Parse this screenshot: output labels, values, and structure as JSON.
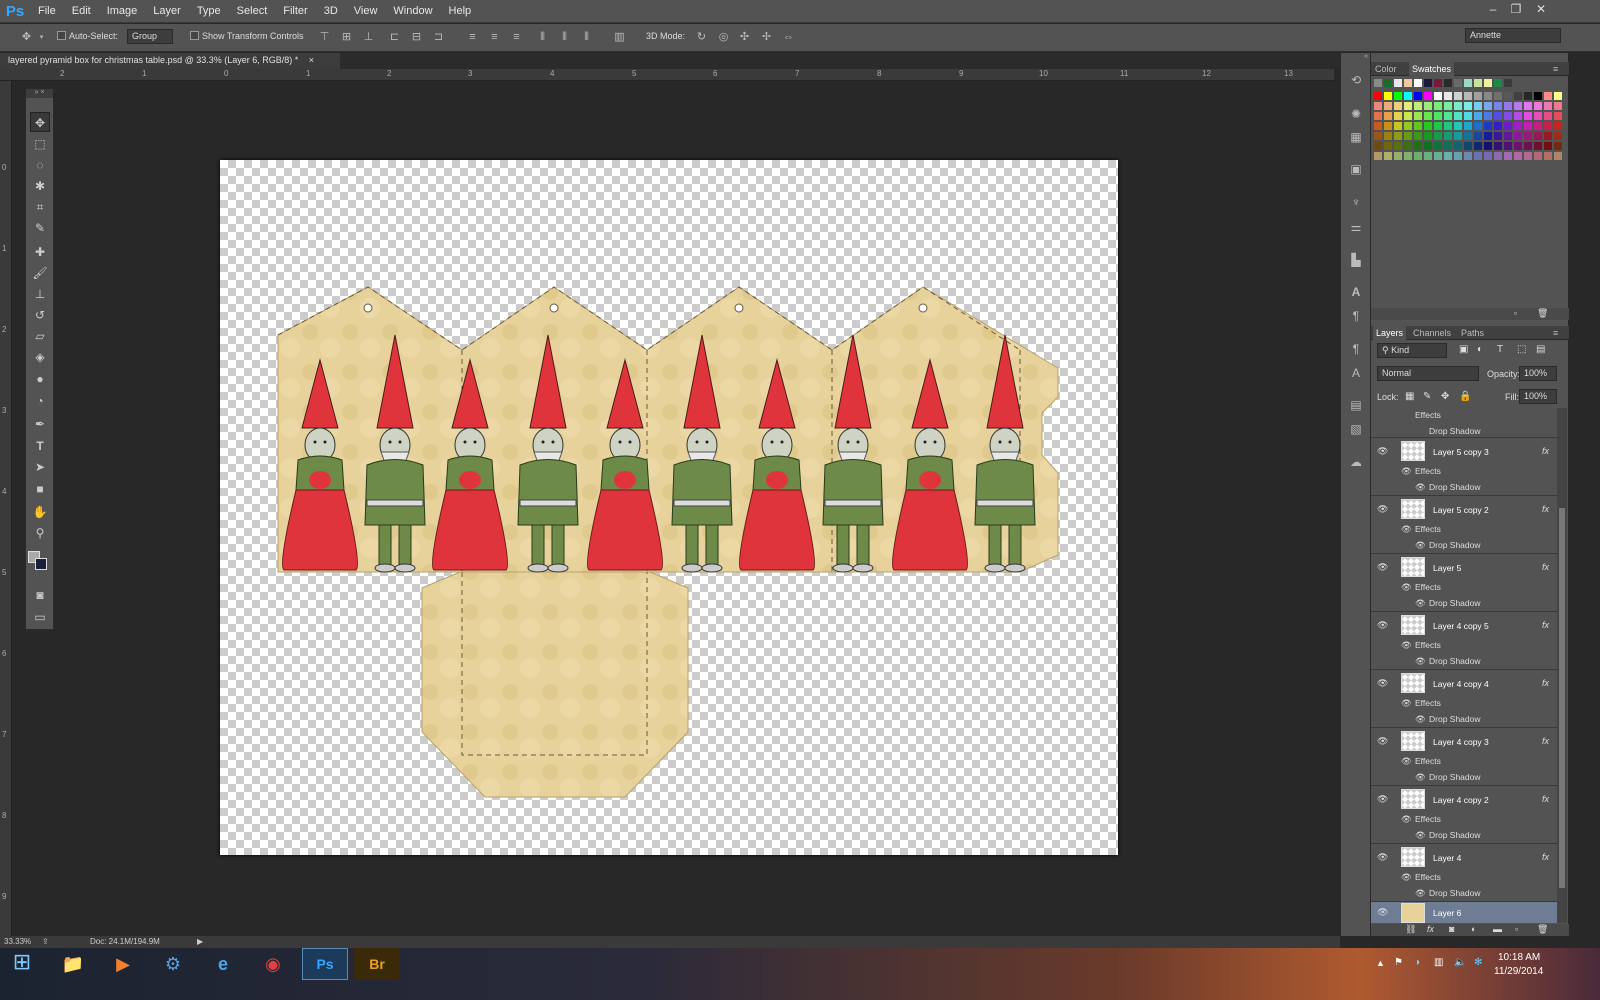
{
  "app": {
    "logo": "Ps"
  },
  "menu": [
    "File",
    "Edit",
    "Image",
    "Layer",
    "Type",
    "Select",
    "Filter",
    "3D",
    "View",
    "Window",
    "Help"
  ],
  "options": {
    "auto_select_label": "Auto-Select:",
    "auto_select_value": "Group",
    "show_transform_label": "Show Transform Controls",
    "mode_label": "3D Mode:",
    "workspace": "Annette"
  },
  "document": {
    "tab_title": "layered pyramid box for christmas table.psd @ 33.3% (Layer 6, RGB/8) *",
    "close": "×"
  },
  "ruler": {
    "h_labels": [
      "2",
      "1",
      "0",
      "1",
      "2",
      "3",
      "4",
      "5",
      "6",
      "7",
      "8",
      "9",
      "10",
      "11",
      "12",
      "13"
    ],
    "v_labels": [
      "0",
      "1",
      "2",
      "3",
      "4",
      "5",
      "6",
      "7",
      "8",
      "9"
    ]
  },
  "status": {
    "zoom": "33.33%",
    "doc": "Doc: 24.1M/194.9M"
  },
  "panels": {
    "color_tabs": [
      "Color",
      "Swatches"
    ],
    "layer_tabs": [
      "Layers",
      "Channels",
      "Paths"
    ],
    "kind": "Kind",
    "blend": "Normal",
    "opacity_label": "Opacity:",
    "opacity": "100%",
    "lock_label": "Lock:",
    "fill_label": "Fill:",
    "fill": "100%"
  },
  "layers_top": {
    "effects": "Effects",
    "drop_shadow": "Drop Shadow"
  },
  "layers": [
    {
      "name": "Layer 5 copy 3",
      "fx": "fx",
      "effects": "Effects",
      "shadow": "Drop Shadow"
    },
    {
      "name": "Layer 5 copy 2",
      "fx": "fx",
      "effects": "Effects",
      "shadow": "Drop Shadow"
    },
    {
      "name": "Layer 5",
      "fx": "fx",
      "effects": "Effects",
      "shadow": "Drop Shadow"
    },
    {
      "name": "Layer 4 copy 5",
      "fx": "fx",
      "effects": "Effects",
      "shadow": "Drop Shadow"
    },
    {
      "name": "Layer 4 copy 4",
      "fx": "fx",
      "effects": "Effects",
      "shadow": "Drop Shadow"
    },
    {
      "name": "Layer 4 copy 3",
      "fx": "fx",
      "effects": "Effects",
      "shadow": "Drop Shadow"
    },
    {
      "name": "Layer 4 copy 2",
      "fx": "fx",
      "effects": "Effects",
      "shadow": "Drop Shadow"
    },
    {
      "name": "Layer 4",
      "fx": "fx",
      "effects": "Effects",
      "shadow": "Drop Shadow"
    }
  ],
  "selected_layer": "Layer 6",
  "taskbar": {
    "time": "10:18 AM",
    "date": "11/29/2014"
  },
  "colors": {
    "selected_layer_bg": "#6f7d94",
    "paper": "#e6d29a",
    "hat_red": "#e0343d",
    "coat_green": "#6e8a48"
  }
}
